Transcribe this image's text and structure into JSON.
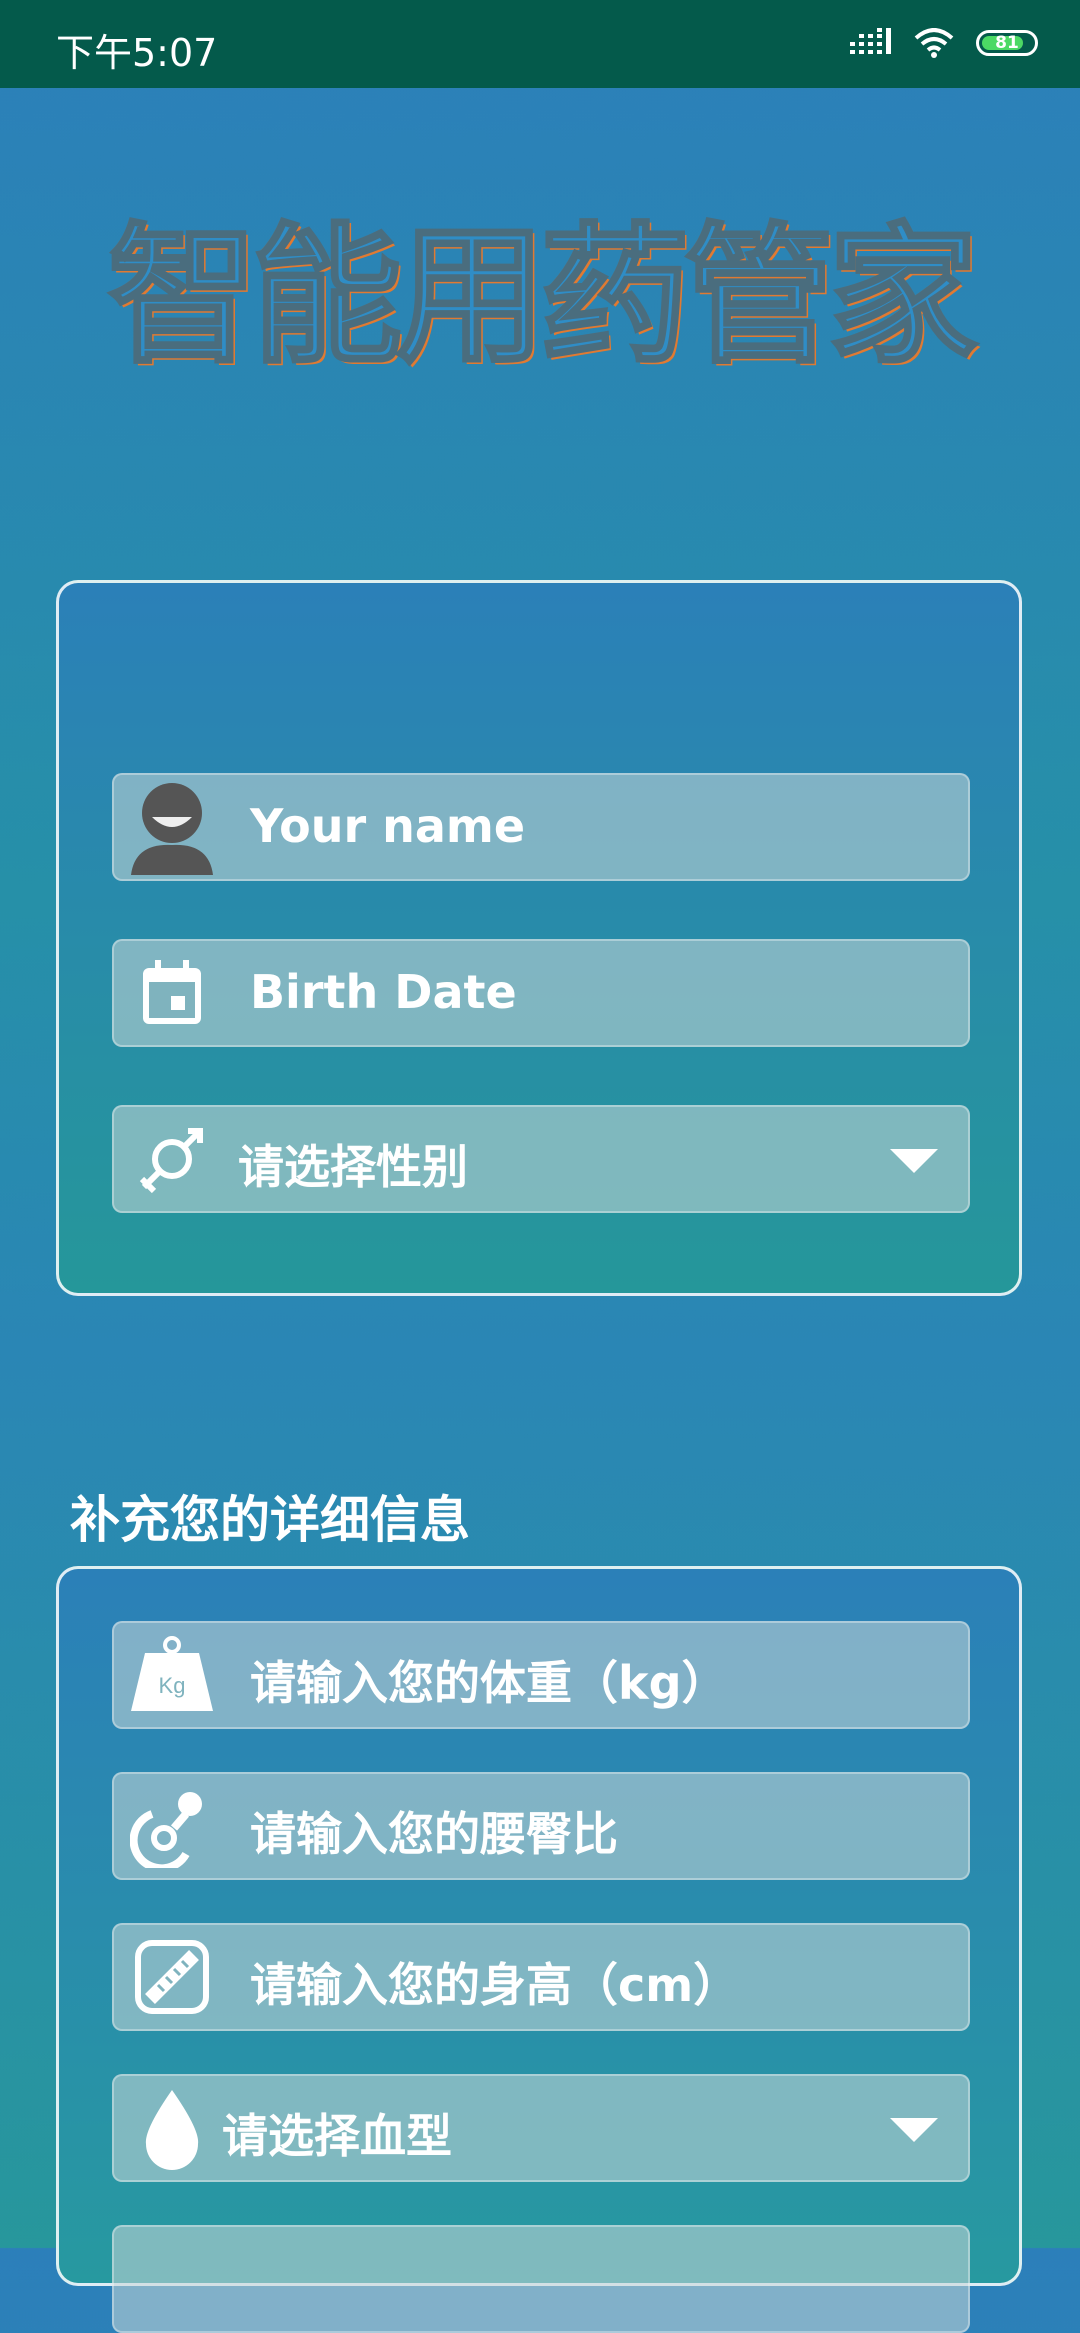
{
  "status_bar": {
    "time": "下午5:07",
    "battery": "81"
  },
  "app": {
    "title": "智能用药管家"
  },
  "basic_info": {
    "name_placeholder": "Your name",
    "birth_placeholder": "Birth Date",
    "gender_placeholder": "请选择性别"
  },
  "details": {
    "heading": "补充您的详细信息",
    "weight_placeholder": "请输入您的体重（kg）",
    "waist_hip_placeholder": "请输入您的腰臀比",
    "height_placeholder": "请输入您的身高（cm）",
    "blood_type_placeholder": "请选择血型"
  },
  "icons": {
    "name": "person-icon",
    "birth": "calendar-icon",
    "gender": "gender-icon",
    "weight": "weight-kg-icon",
    "waist_hip": "pacifier-icon",
    "height": "ruler-icon",
    "blood": "drop-icon"
  },
  "colors": {
    "status_bar": "#045a4b",
    "title_fill": "#2f8dc6",
    "title_outline": "#e07a32"
  }
}
